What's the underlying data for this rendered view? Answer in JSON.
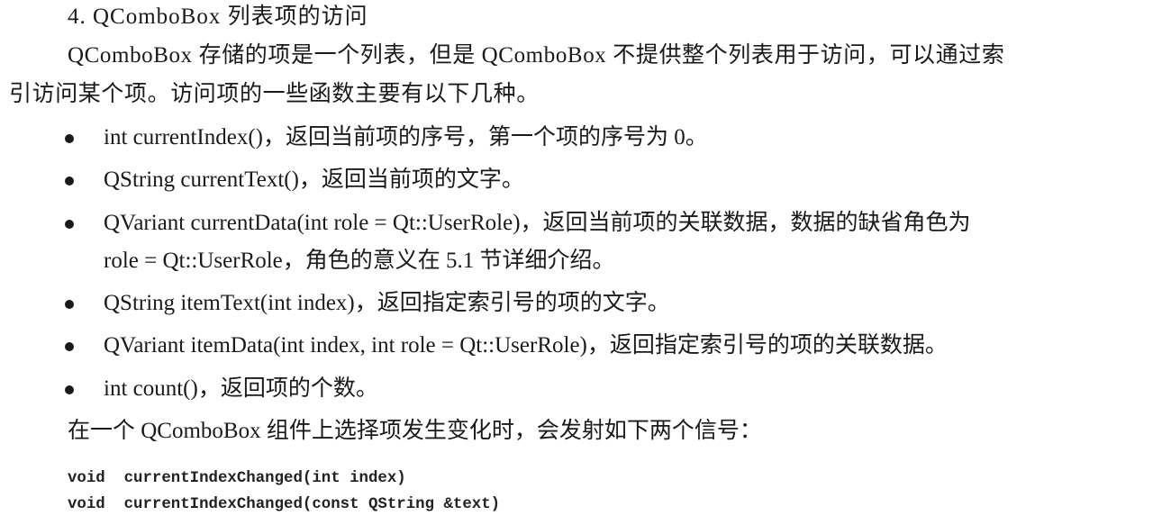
{
  "heading": "4.  QComboBox 列表项的访问",
  "intro": [
    "QComboBox 存储的项是一个列表，但是 QComboBox 不提供整个列表用于访问，可以通过索",
    "引访问某个项。访问项的一些函数主要有以下几种。"
  ],
  "bullets": [
    [
      "int currentIndex()，返回当前项的序号，第一个项的序号为 0。"
    ],
    [
      "QString currentText()，返回当前项的文字。"
    ],
    [
      "QVariant currentData(int role = Qt::UserRole)，返回当前项的关联数据，数据的缺省角色为",
      "role = Qt::UserRole，角色的意义在 5.1 节详细介绍。"
    ],
    [
      "QString itemText(int index)，返回指定索引号的项的文字。"
    ],
    [
      "QVariant itemData(int index, int role = Qt::UserRole)，返回指定索引号的项的关联数据。"
    ],
    [
      "int count()，返回项的个数。"
    ]
  ],
  "signals_intro": "在一个 QComboBox 组件上选择项发生变化时，会发射如下两个信号：",
  "code": [
    "void  currentIndexChanged(int index)",
    "void  currentIndexChanged(const QString &text)"
  ]
}
